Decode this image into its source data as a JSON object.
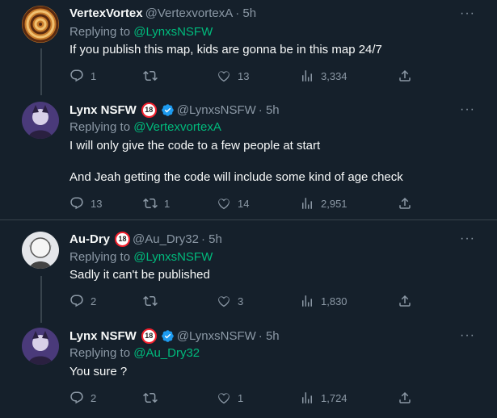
{
  "tweets": [
    {
      "name": "VertexVortex",
      "handle": "@VertexvortexA",
      "time": "· 5h",
      "reply_label": "Replying to",
      "reply_handle": "@LynxsNSFW",
      "text": [
        "If you publish this map, kids are gonna be in this map 24/7"
      ],
      "replies": "1",
      "retweets": "",
      "likes": "13",
      "views": "3,334"
    },
    {
      "name": "Lynx NSFW",
      "badge": "18",
      "handle": "@LynxsNSFW",
      "time": "· 5h",
      "reply_label": "Replying to",
      "reply_handle": "@VertexvortexA",
      "text": [
        "I will only give the code to a few people at start",
        "And Jeah getting the code will include some kind of age check"
      ],
      "replies": "13",
      "retweets": "1",
      "likes": "14",
      "views": "2,951"
    },
    {
      "name": "Au-Dry",
      "badge": "18",
      "handle": "@Au_Dry32",
      "time": "· 5h",
      "reply_label": "Replying to",
      "reply_handle": "@LynxsNSFW",
      "text": [
        "Sadly it can't be published"
      ],
      "replies": "2",
      "retweets": "",
      "likes": "3",
      "views": "1,830"
    },
    {
      "name": "Lynx NSFW",
      "badge": "18",
      "handle": "@LynxsNSFW",
      "time": "· 5h",
      "reply_label": "Replying to",
      "reply_handle": "@Au_Dry32",
      "text": [
        "You sure ?"
      ],
      "replies": "2",
      "retweets": "",
      "likes": "1",
      "views": "1,724"
    }
  ],
  "more_glyph": "···",
  "colors": {
    "background": "#15202b",
    "link": "#00ba7c",
    "muted": "#8b98a5",
    "verified": "#1d9bf0",
    "badge_ring": "#f4212e"
  }
}
